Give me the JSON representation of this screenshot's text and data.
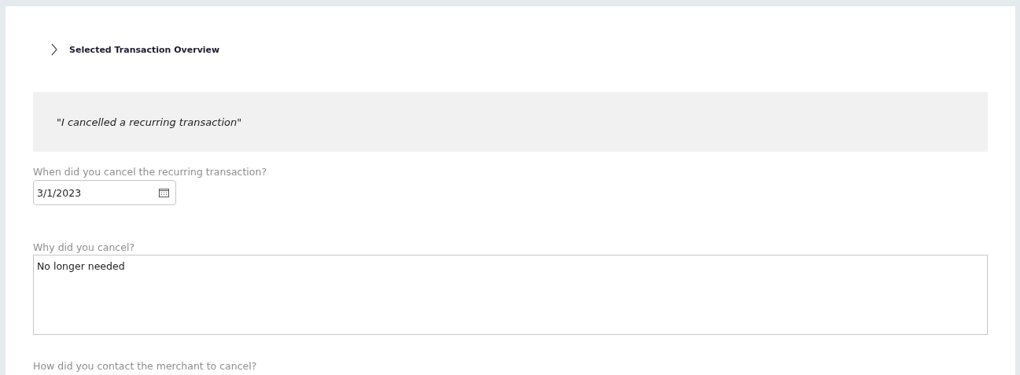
{
  "section": {
    "title": "Selected Transaction Overview",
    "expanded": false
  },
  "quote": "\"I cancelled a recurring transaction\"",
  "fields": [
    {
      "kind": "date",
      "label": "When did you cancel the recurring transaction?",
      "value": "3/1/2023"
    },
    {
      "kind": "textarea",
      "label": "Why did you cancel?",
      "value": "No longer needed"
    },
    {
      "kind": "heading",
      "label": "How did you contact the merchant to cancel?"
    }
  ]
}
